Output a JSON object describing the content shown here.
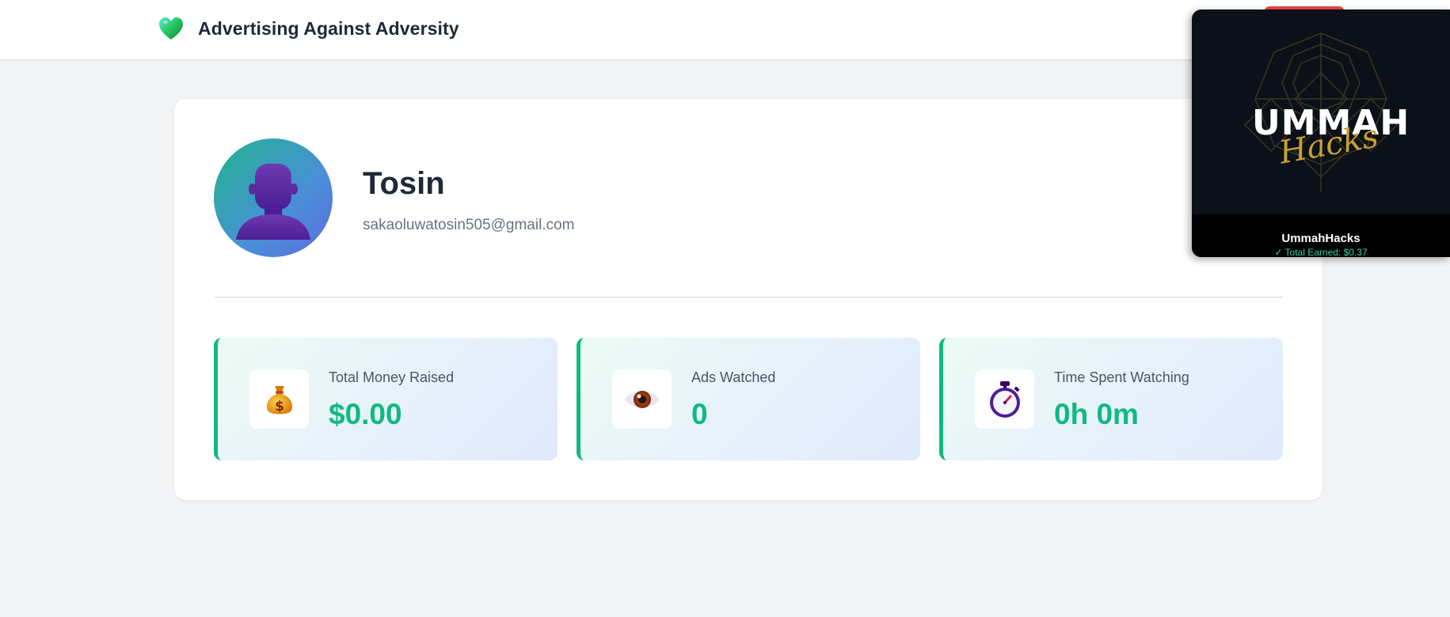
{
  "header": {
    "title": "Advertising Against Adversity",
    "logo_icon": "green-heart-icon"
  },
  "profile": {
    "name": "Tosin",
    "email": "sakaoluwatosin505@gmail.com",
    "avatar_icon": "person-silhouette-icon"
  },
  "stats": [
    {
      "label": "Total Money Raised",
      "value": "$0.00",
      "icon": "money-bag-icon"
    },
    {
      "label": "Ads Watched",
      "value": "0",
      "icon": "eye-icon"
    },
    {
      "label": "Time Spent Watching",
      "value": "0h 0m",
      "icon": "stopwatch-icon"
    }
  ],
  "ad_popup": {
    "logo_main": "UMMAH",
    "logo_script": "Hacks",
    "name": "UmmahHacks",
    "earned": "✓ Total Earned: $0.37",
    "progress": 1.0
  },
  "colors": {
    "accent": "#10b981",
    "heading": "#1f2937",
    "muted": "#6b7280",
    "background": "#f2f3f5"
  }
}
